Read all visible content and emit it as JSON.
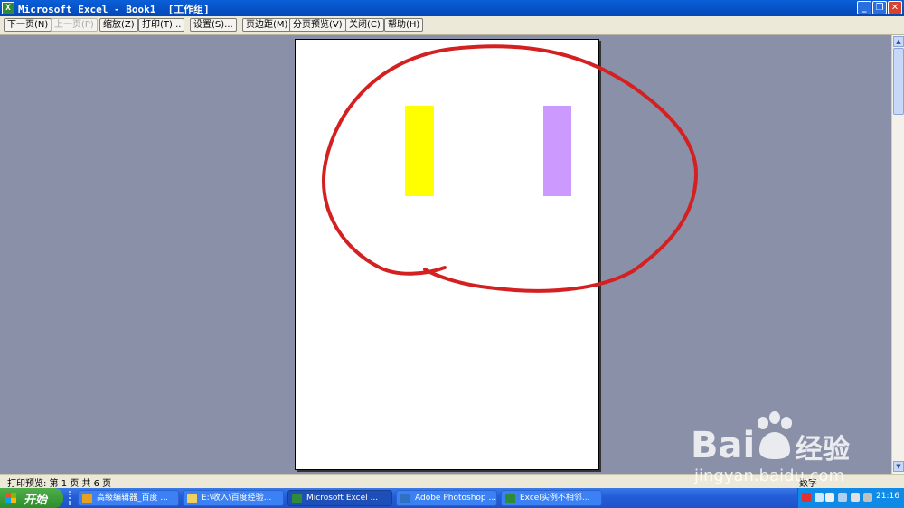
{
  "window": {
    "title": "Microsoft Excel - Book1  [工作组]",
    "app_icon_letter": "X",
    "minimize": "_",
    "restore": "❐",
    "close": "✕"
  },
  "toolbar": {
    "next_page": "下一页(N)",
    "prev_page": "上一页(P)",
    "zoom": "缩放(Z)",
    "print": "打印(T)...",
    "setup": "设置(S)...",
    "margins": "页边距(M)",
    "page_break_preview": "分页预览(V)",
    "close": "关闭(C)",
    "help": "帮助(H)"
  },
  "page_content": {
    "shapes": [
      {
        "name": "yellow-rectangle",
        "color": "#ffff00"
      },
      {
        "name": "purple-rectangle",
        "color": "#cc99ff"
      }
    ],
    "annotation_color": "#d42020"
  },
  "status": {
    "text": "打印预览: 第 1 页  共 6 页",
    "num": "数字"
  },
  "taskbar": {
    "start_label": "开始",
    "tasks": [
      {
        "label": "高级编辑器_百度 ...",
        "icon_color": "#e8a020"
      },
      {
        "label": "E:\\收入\\百度经验...",
        "icon_color": "#f0d060"
      },
      {
        "label": "Microsoft Excel ...",
        "icon_color": "#2e8b3a"
      },
      {
        "label": "Adobe Photoshop ...",
        "icon_color": "#3070c0"
      },
      {
        "label": "Excel实例不相邻...",
        "icon_color": "#2e8b3a"
      }
    ],
    "clock": "21:16"
  },
  "watermark": {
    "brand_a": "Bai",
    "brand_b": "经验",
    "url": "jingyan.baidu.com"
  }
}
